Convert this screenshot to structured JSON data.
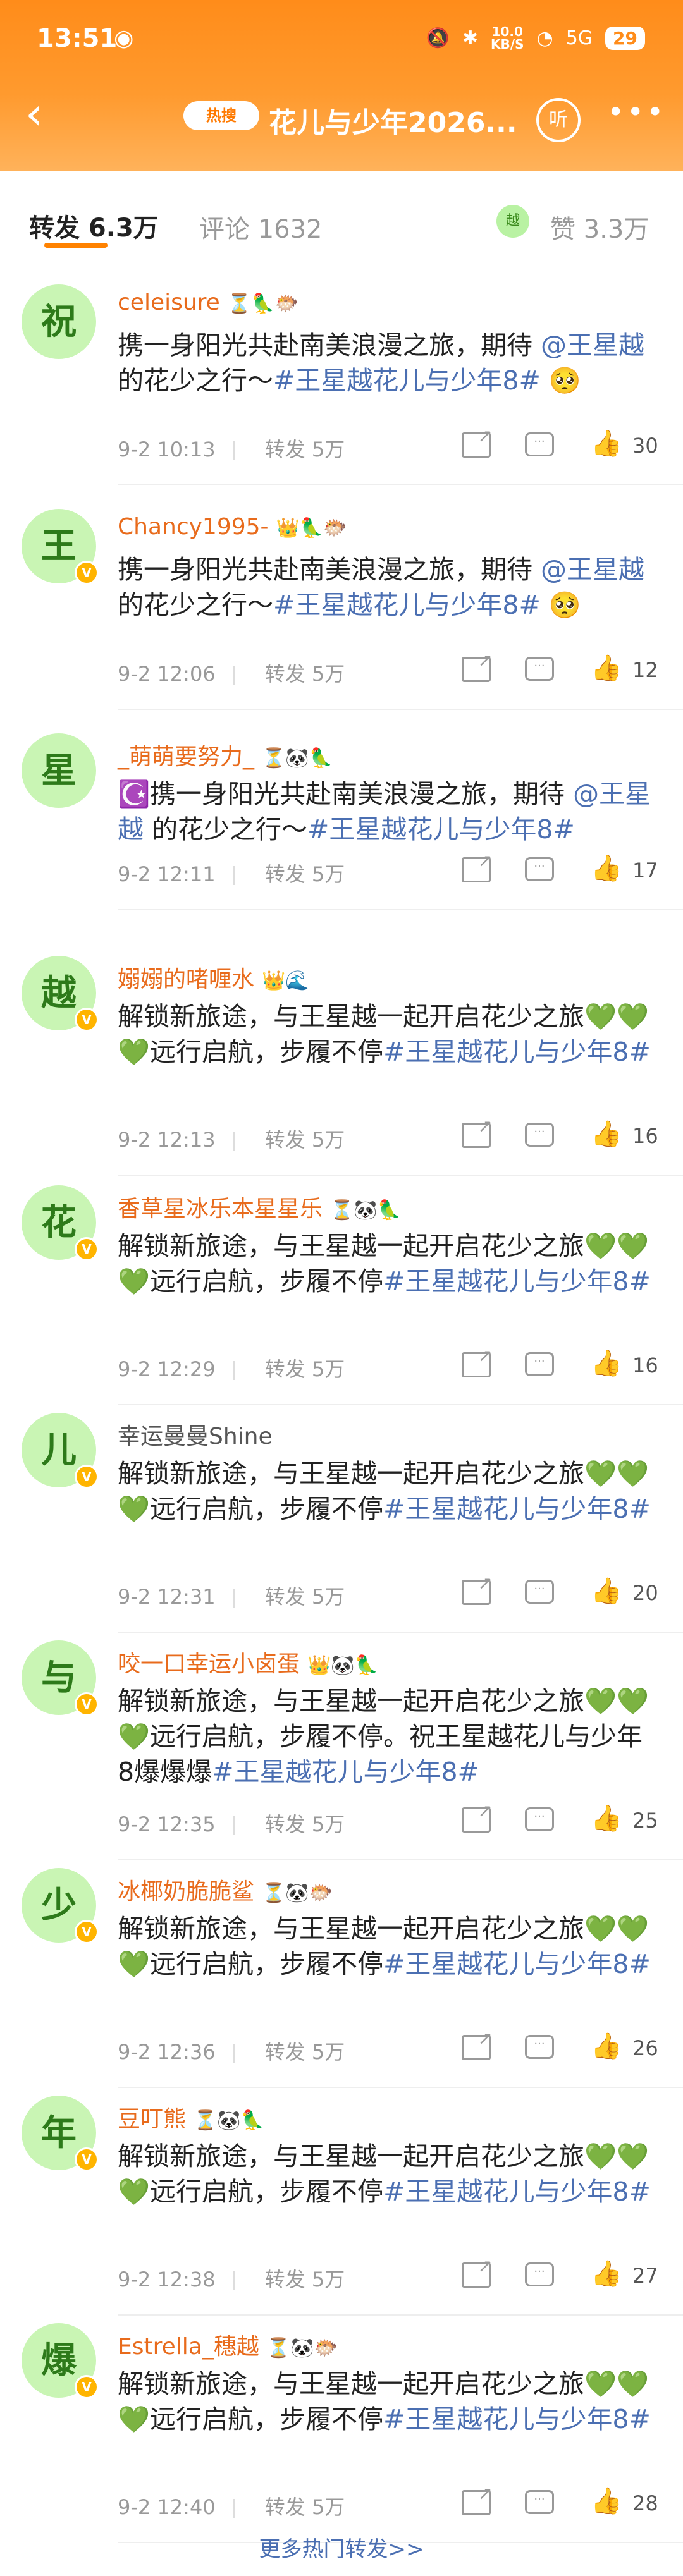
{
  "status": {
    "time": "13:51",
    "net_speed": "10.0",
    "net_unit": "KB/S",
    "signal": "5G",
    "battery": "29"
  },
  "nav": {
    "hot_badge": "热搜",
    "title": "花儿与少年2026...",
    "listen": "听"
  },
  "tabs": {
    "repost": "转发 6.3万",
    "comment": "评论 1632",
    "like": "赞 3.3万",
    "like_avatar": "越"
  },
  "items": [
    {
      "avatar": "祝",
      "name": "celeisure",
      "name_color": "orange",
      "badges": "⏳🦜🐡",
      "verified": false,
      "text_a": "携一身阳光共赴南美浪漫之旅，期待 ",
      "mention": "@王星越",
      "text_b": " 的花少之行～",
      "hashtag": "#王星越花儿与少年8#",
      "text_c": " 🥺",
      "time": "9-2 10:13",
      "reposts": "转发 5万",
      "likes": "30"
    },
    {
      "avatar": "王",
      "name": "Chancy1995-",
      "name_color": "orange",
      "badges": "👑🦜🐡",
      "verified": true,
      "text_a": "携一身阳光共赴南美浪漫之旅，期待 ",
      "mention": "@王星越",
      "text_b": " 的花少之行～",
      "hashtag": "#王星越花儿与少年8#",
      "text_c": " 🥺",
      "time": "9-2 12:06",
      "reposts": "转发 5万",
      "likes": "12"
    },
    {
      "avatar": "星",
      "name": "_萌萌要努力_",
      "name_color": "orange",
      "badges": "⏳🐼🦜",
      "verified": false,
      "text_a": "☪️携一身阳光共赴南美浪漫之旅，期待 ",
      "mention": "@王星越",
      "text_b": " 的花少之行～",
      "hashtag": "#王星越花儿与少年8#",
      "text_c": "",
      "time": "9-2 12:11",
      "reposts": "转发 5万",
      "likes": "17"
    },
    {
      "avatar": "越",
      "name": "嫋嫋的啫喱水",
      "name_color": "orange",
      "badges": "👑🌊",
      "verified": true,
      "text_a": "解锁新旅途，与王星越一起开启花少之旅💚💚💚远行启航，步履不停",
      "mention": "",
      "text_b": "",
      "hashtag": "#王星越花儿与少年8#",
      "text_c": "",
      "time": "9-2 12:13",
      "reposts": "转发 5万",
      "likes": "16"
    },
    {
      "avatar": "花",
      "name": "香草星冰乐本星星乐",
      "name_color": "orange",
      "badges": "⏳🐼🦜",
      "verified": true,
      "text_a": "解锁新旅途，与王星越一起开启花少之旅💚💚💚远行启航，步履不停",
      "mention": "",
      "text_b": "",
      "hashtag": "#王星越花儿与少年8#",
      "text_c": "",
      "time": "9-2 12:29",
      "reposts": "转发 5万",
      "likes": "16"
    },
    {
      "avatar": "儿",
      "name": "幸运曼曼Shine",
      "name_color": "plain",
      "badges": "",
      "verified": true,
      "text_a": "解锁新旅途，与王星越一起开启花少之旅💚💚💚远行启航，步履不停",
      "mention": "",
      "text_b": "",
      "hashtag": "#王星越花儿与少年8#",
      "text_c": "",
      "time": "9-2 12:31",
      "reposts": "转发 5万",
      "likes": "20"
    },
    {
      "avatar": "与",
      "name": "咬一口幸运小卤蛋",
      "name_color": "orange",
      "badges": "👑🐼🦜",
      "verified": true,
      "text_a": "解锁新旅途，与王星越一起开启花少之旅💚💚💚远行启航，步履不停。祝王星越花儿与少年8爆爆爆",
      "mention": "",
      "text_b": "",
      "hashtag": "#王星越花儿与少年8#",
      "text_c": "",
      "time": "9-2 12:35",
      "reposts": "转发 5万",
      "likes": "25"
    },
    {
      "avatar": "少",
      "name": "冰椰奶脆脆鲨",
      "name_color": "orange",
      "badges": "⏳🐼🐡",
      "verified": true,
      "text_a": "解锁新旅途，与王星越一起开启花少之旅💚💚💚远行启航，步履不停",
      "mention": "",
      "text_b": "",
      "hashtag": "#王星越花儿与少年8#",
      "text_c": "",
      "time": "9-2 12:36",
      "reposts": "转发 5万",
      "likes": "26"
    },
    {
      "avatar": "年",
      "name": "豆叮熊",
      "name_color": "orange",
      "badges": "⏳🐼🦜",
      "verified": true,
      "text_a": "解锁新旅途，与王星越一起开启花少之旅💚💚💚远行启航，步履不停",
      "mention": "",
      "text_b": "",
      "hashtag": "#王星越花儿与少年8#",
      "text_c": "",
      "time": "9-2 12:38",
      "reposts": "转发 5万",
      "likes": "27"
    },
    {
      "avatar": "爆",
      "name": "Estrella_穗越",
      "name_color": "orange",
      "badges": "⏳🐼🐡",
      "verified": true,
      "text_a": "解锁新旅途，与王星越一起开启花少之旅💚💚💚远行启航，步履不停",
      "mention": "",
      "text_b": "",
      "hashtag": "#王星越花儿与少年8#",
      "text_c": "",
      "time": "9-2 12:40",
      "reposts": "转发 5万",
      "likes": "28"
    }
  ],
  "footer": {
    "more": "更多热门转发>>"
  }
}
